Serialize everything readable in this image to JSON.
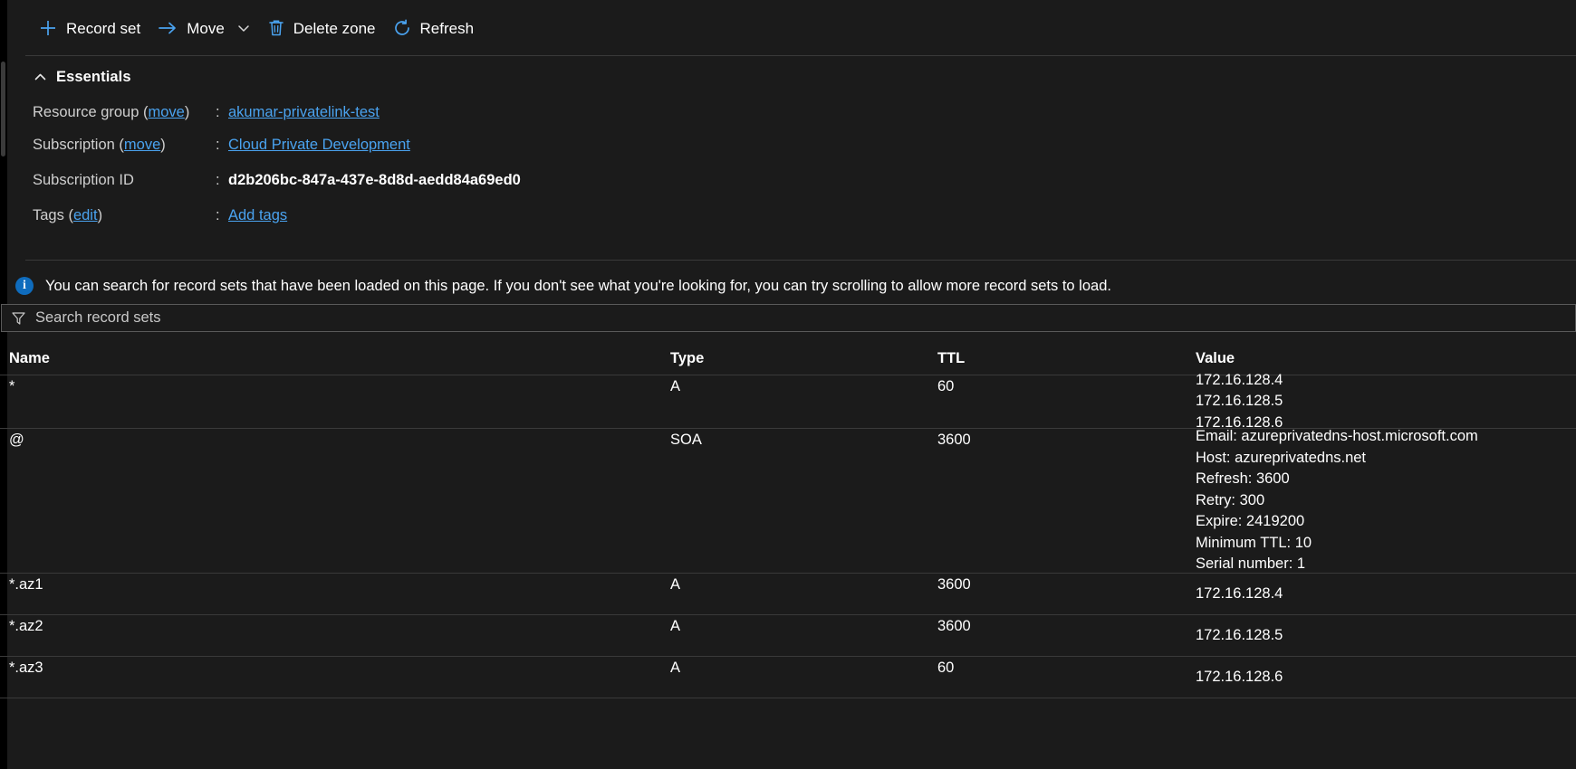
{
  "toolbar": {
    "items": [
      {
        "label": "Record set",
        "icon": "plus-icon"
      },
      {
        "label": "Move",
        "icon": "arrow-right-icon",
        "has_chevron": true
      },
      {
        "label": "Delete zone",
        "icon": "trash-icon"
      },
      {
        "label": "Refresh",
        "icon": "refresh-icon"
      }
    ]
  },
  "essentials": {
    "title": "Essentials",
    "collapse_icon": "chevron-up-icon",
    "rows": [
      {
        "label": "Resource group",
        "label_link": "move",
        "colon": ":",
        "value": "akumar-privatelink-test",
        "value_is_link": true
      },
      {
        "label": "Subscription",
        "label_link": "move",
        "colon": ":",
        "value": "Cloud Private Development",
        "value_is_link": true
      },
      {
        "label": "Subscription ID",
        "label_link": "",
        "colon": ":",
        "value": "d2b206bc-847a-437e-8d8d-aedd84a69ed0",
        "value_is_link": false
      },
      {
        "label": "Tags",
        "label_link": "edit",
        "colon": ":",
        "value": "Add tags",
        "value_is_link": true
      }
    ]
  },
  "info_banner": {
    "icon": "info-icon",
    "glyph": "i",
    "text": "You can search for record sets that have been loaded on this page. If you don't see what you're looking for, you can try scrolling to allow more record sets to load."
  },
  "search": {
    "icon": "filter-icon",
    "placeholder": "Search record sets",
    "value": ""
  },
  "table": {
    "columns": [
      "Name",
      "Type",
      "TTL",
      "Value"
    ],
    "rows": [
      {
        "name": "*",
        "type": "A",
        "ttl": "60",
        "value_lines": [
          "172.16.128.4",
          "172.16.128.5",
          "172.16.128.6"
        ],
        "size": "a"
      },
      {
        "name": "@",
        "type": "SOA",
        "ttl": "3600",
        "value_lines": [
          "Email: azureprivatedns-host.microsoft.com",
          "Host: azureprivatedns.net",
          "Refresh: 3600",
          "Retry: 300",
          "Expire: 2419200",
          "Minimum TTL: 10",
          "Serial number: 1"
        ],
        "size": "soa"
      },
      {
        "name": "*.az1",
        "type": "A",
        "ttl": "3600",
        "value_lines": [
          "172.16.128.4"
        ],
        "size": "std"
      },
      {
        "name": "*.az2",
        "type": "A",
        "ttl": "3600",
        "value_lines": [
          "172.16.128.5"
        ],
        "size": "std"
      },
      {
        "name": "*.az3",
        "type": "A",
        "ttl": "60",
        "value_lines": [
          "172.16.128.6"
        ],
        "size": "std"
      }
    ]
  },
  "colors": {
    "background": "#1b1b1b",
    "link": "#4aa3f0",
    "accent": "#0f6cbd",
    "border": "#3a3a3a",
    "text": "#ffffff",
    "muted": "#cfcfcf"
  }
}
